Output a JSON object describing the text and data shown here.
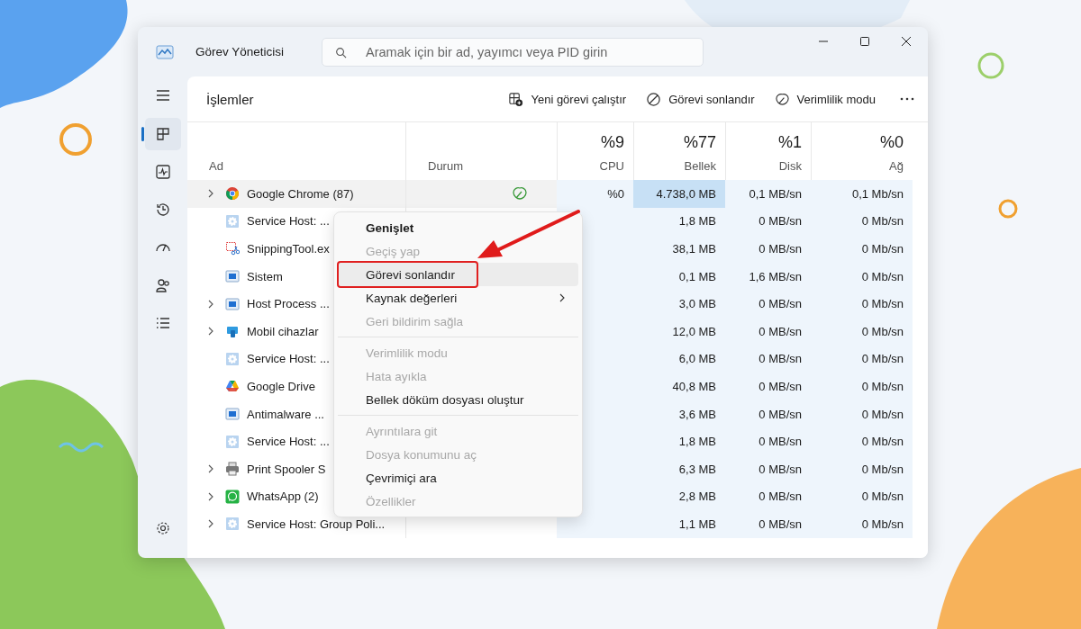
{
  "window": {
    "title": "Görev Yöneticisi",
    "search_placeholder": "Aramak için bir ad, yayımcı veya PID girin"
  },
  "sidebar": {
    "items": [
      {
        "kind": "processes",
        "selected": true
      },
      {
        "kind": "performance",
        "selected": false
      },
      {
        "kind": "history",
        "selected": false
      },
      {
        "kind": "startup",
        "selected": false
      },
      {
        "kind": "users",
        "selected": false
      },
      {
        "kind": "details",
        "selected": false
      }
    ]
  },
  "page": {
    "title": "İşlemler",
    "actions": [
      {
        "kind": "run",
        "label": "Yeni görevi çalıştır"
      },
      {
        "kind": "end",
        "label": "Görevi sonlandır"
      },
      {
        "kind": "efficiency",
        "label": "Verimlilik modu"
      }
    ]
  },
  "table": {
    "columns": [
      {
        "label": "Ad"
      },
      {
        "label": "Durum"
      },
      {
        "percent": "%9",
        "label": "CPU"
      },
      {
        "percent": "%77",
        "label": "Bellek"
      },
      {
        "percent": "%1",
        "label": "Disk"
      },
      {
        "percent": "%0",
        "label": "Ağ"
      }
    ],
    "rows": [
      {
        "name": "Google Chrome (87)",
        "kind": "chrome",
        "expandable": true,
        "hovered": true,
        "efficiency": true,
        "cpu": "%0",
        "memory": "4.738,0 MB",
        "memory_hot": true,
        "disk": "0,1 MB/sn",
        "network": "0,1 Mb/sn"
      },
      {
        "name": "Service Host: ...",
        "kind": "gear",
        "expandable": false,
        "hovered": false,
        "efficiency": false,
        "memory": "1,8 MB",
        "memory_hot": false,
        "disk": "0 MB/sn",
        "network": "0 Mb/sn"
      },
      {
        "name": "SnippingTool.ex",
        "kind": "snip",
        "expandable": false,
        "hovered": false,
        "efficiency": false,
        "memory": "38,1 MB",
        "memory_hot": false,
        "disk": "0 MB/sn",
        "network": "0 Mb/sn"
      },
      {
        "name": "Sistem",
        "kind": "app",
        "expandable": false,
        "hovered": false,
        "efficiency": false,
        "memory": "0,1 MB",
        "memory_hot": false,
        "disk": "1,6 MB/sn",
        "network": "0 Mb/sn"
      },
      {
        "name": "Host Process ...",
        "kind": "app",
        "expandable": true,
        "hovered": false,
        "efficiency": false,
        "memory": "3,0 MB",
        "memory_hot": false,
        "disk": "0 MB/sn",
        "network": "0 Mb/sn"
      },
      {
        "name": "Mobil cihazlar",
        "kind": "mobile",
        "expandable": true,
        "hovered": false,
        "efficiency": false,
        "memory": "12,0 MB",
        "memory_hot": false,
        "disk": "0 MB/sn",
        "network": "0 Mb/sn"
      },
      {
        "name": "Service Host: ...",
        "kind": "gear",
        "expandable": false,
        "hovered": false,
        "efficiency": false,
        "memory": "6,0 MB",
        "memory_hot": false,
        "disk": "0 MB/sn",
        "network": "0 Mb/sn"
      },
      {
        "name": "Google Drive",
        "kind": "drive",
        "expandable": false,
        "hovered": false,
        "efficiency": false,
        "memory": "40,8 MB",
        "memory_hot": false,
        "disk": "0 MB/sn",
        "network": "0 Mb/sn"
      },
      {
        "name": "Antimalware ...",
        "kind": "app",
        "expandable": false,
        "hovered": false,
        "efficiency": false,
        "memory": "3,6 MB",
        "memory_hot": false,
        "disk": "0 MB/sn",
        "network": "0 Mb/sn"
      },
      {
        "name": "Service Host: ...",
        "kind": "gear",
        "expandable": false,
        "hovered": false,
        "efficiency": false,
        "memory": "1,8 MB",
        "memory_hot": false,
        "disk": "0 MB/sn",
        "network": "0 Mb/sn"
      },
      {
        "name": "Print Spooler S",
        "kind": "printer",
        "expandable": true,
        "hovered": false,
        "efficiency": false,
        "memory": "6,3 MB",
        "memory_hot": false,
        "disk": "0 MB/sn",
        "network": "0 Mb/sn"
      },
      {
        "name": "WhatsApp (2)",
        "kind": "whatsapp",
        "expandable": true,
        "hovered": false,
        "efficiency": false,
        "memory": "2,8 MB",
        "memory_hot": false,
        "disk": "0 MB/sn",
        "network": "0 Mb/sn"
      },
      {
        "name": "Service Host: Group Poli...",
        "kind": "gear",
        "expandable": true,
        "hovered": false,
        "efficiency": false,
        "memory": "1,1 MB",
        "memory_hot": false,
        "disk": "0 MB/sn",
        "network": "0 Mb/sn"
      }
    ]
  },
  "context_menu": {
    "items": [
      {
        "kind": "item",
        "label": "Genişlet",
        "default": true,
        "disabled": false,
        "hovered": false,
        "submenu": false
      },
      {
        "kind": "item",
        "label": "Geçiş yap",
        "default": false,
        "disabled": true,
        "hovered": false,
        "submenu": false
      },
      {
        "kind": "item",
        "label": "Görevi sonlandır",
        "default": false,
        "disabled": false,
        "hovered": true,
        "submenu": false
      },
      {
        "kind": "item",
        "label": "Kaynak değerleri",
        "default": false,
        "disabled": false,
        "hovered": false,
        "submenu": true
      },
      {
        "kind": "item",
        "label": "Geri bildirim sağla",
        "default": false,
        "disabled": true,
        "hovered": false,
        "submenu": false
      },
      {
        "kind": "separator"
      },
      {
        "kind": "item",
        "label": "Verimlilik modu",
        "default": false,
        "disabled": true,
        "hovered": false,
        "submenu": false
      },
      {
        "kind": "item",
        "label": "Hata ayıkla",
        "default": false,
        "disabled": true,
        "hovered": false,
        "submenu": false
      },
      {
        "kind": "item",
        "label": "Bellek döküm dosyası oluştur",
        "default": false,
        "disabled": false,
        "hovered": false,
        "submenu": false
      },
      {
        "kind": "separator"
      },
      {
        "kind": "item",
        "label": "Ayrıntılara git",
        "default": false,
        "disabled": true,
        "hovered": false,
        "submenu": false
      },
      {
        "kind": "item",
        "label": "Dosya konumunu aç",
        "default": false,
        "disabled": true,
        "hovered": false,
        "submenu": false
      },
      {
        "kind": "item",
        "label": "Çevrimiçi ara",
        "default": false,
        "disabled": false,
        "hovered": false,
        "submenu": false
      },
      {
        "kind": "item",
        "label": "Özellikler",
        "default": false,
        "disabled": true,
        "hovered": false,
        "submenu": false
      }
    ]
  }
}
